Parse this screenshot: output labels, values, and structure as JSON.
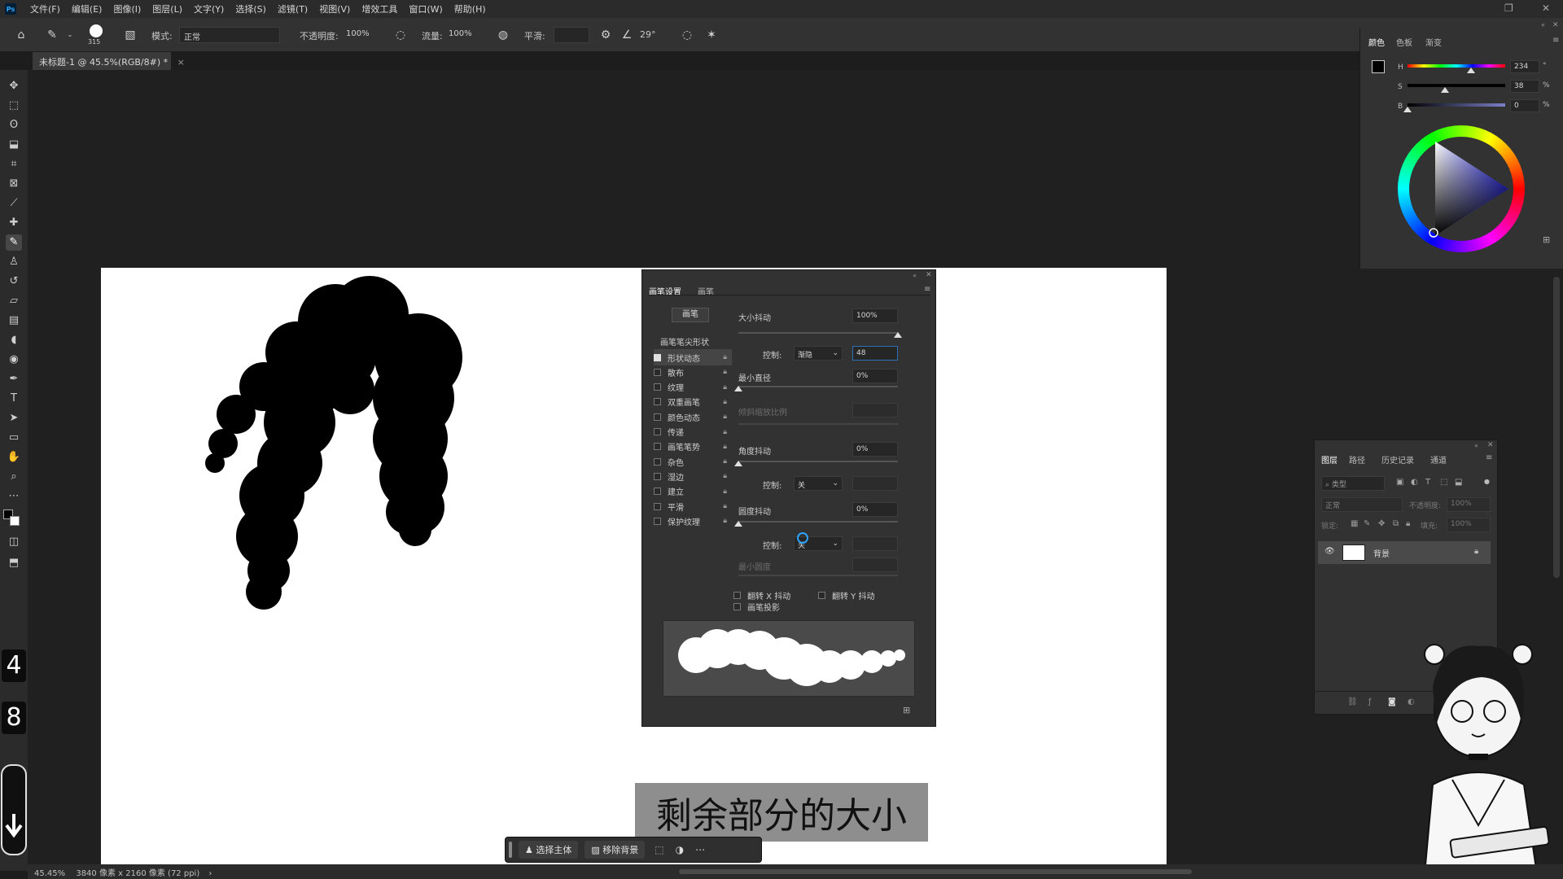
{
  "menu": {
    "app_logo": "Ps",
    "items": [
      "文件(F)",
      "编辑(E)",
      "图像(I)",
      "图层(L)",
      "文字(Y)",
      "选择(S)",
      "滤镜(T)",
      "视图(V)",
      "增效工具",
      "窗口(W)",
      "帮助(H)"
    ]
  },
  "options": {
    "brush_size": "315",
    "mode_label": "模式:",
    "mode_value": "正常",
    "opacity_label": "不透明度:",
    "opacity_value": "100%",
    "flow_label": "流量:",
    "flow_value": "100%",
    "smoothing_label": "平滑:",
    "smoothing_value": "",
    "angle_value": "29°"
  },
  "document": {
    "tab_title": "未标题-1 @ 45.5%(RGB/8#) *",
    "zoom": "45.45%",
    "doc_info": "3840 像素 x 2160 像素 (72 ppi)"
  },
  "toolbar_keys": [
    "4",
    "8"
  ],
  "brush_panel": {
    "tabs": [
      "画笔设置",
      "画笔"
    ],
    "brush_button": "画笔",
    "tip_shape": "画笔笔尖形状",
    "options": [
      {
        "label": "形状动态",
        "checked": true
      },
      {
        "label": "散布",
        "checked": false
      },
      {
        "label": "纹理",
        "checked": false
      },
      {
        "label": "双重画笔",
        "checked": false
      },
      {
        "label": "颜色动态",
        "checked": false
      },
      {
        "label": "传递",
        "checked": false
      },
      {
        "label": "画笔笔势",
        "checked": false
      },
      {
        "label": "杂色",
        "checked": false
      },
      {
        "label": "湿边",
        "checked": false
      },
      {
        "label": "建立",
        "checked": false
      },
      {
        "label": "平滑",
        "checked": false
      },
      {
        "label": "保护纹理",
        "checked": false
      }
    ],
    "size_jitter_label": "大小抖动",
    "size_jitter_value": "100%",
    "size_jitter_level": 1.0,
    "control_label": "控制:",
    "control_value": "渐隐",
    "fade_steps": "48",
    "min_diameter_label": "最小直径",
    "min_diameter_value": "0%",
    "min_diameter_level": 0,
    "tilt_scale_label": "倾斜缩放比例",
    "angle_jitter_label": "角度抖动",
    "angle_jitter_value": "0%",
    "angle_jitter_level": 0,
    "angle_control_label": "控制:",
    "angle_control_value": "关",
    "roundness_jitter_label": "圆度抖动",
    "roundness_jitter_value": "0%",
    "roundness_jitter_level": 0,
    "roundness_control_label": "控制:",
    "roundness_control_value": "关",
    "min_roundness_label": "最小圆度",
    "flip_x_label": "翻转 X 抖动",
    "flip_y_label": "翻转 Y 抖动",
    "brush_projection_label": "画笔投影"
  },
  "color_panel": {
    "tabs": [
      "颜色",
      "色板",
      "渐变"
    ],
    "h_label": "H",
    "h_value": "234",
    "h_level": 0.65,
    "s_label": "S",
    "s_value": "38",
    "s_level": 0.38,
    "b_label": "B",
    "b_value": "0",
    "b_level": 0,
    "pct": "%",
    "deg": "°"
  },
  "layers_panel": {
    "tabs": [
      "图层",
      "路径",
      "历史记录",
      "通道"
    ],
    "search_placeholder": "类型",
    "blend_mode": "正常",
    "opacity_label": "不透明度:",
    "opacity_value": "100%",
    "lock_label": "锁定:",
    "fill_label": "填充:",
    "fill_value": "100%",
    "layer_name": "背景"
  },
  "context_bar": {
    "select_subject": "选择主体",
    "remove_bg": "移除背景"
  },
  "subtitle": "剩余部分的大小",
  "colors": {
    "accent": "#31a8ff",
    "panel_bg": "#323232",
    "app_bg": "#1d1d1d",
    "canvas": "#ffffff",
    "ink": "#000000"
  }
}
